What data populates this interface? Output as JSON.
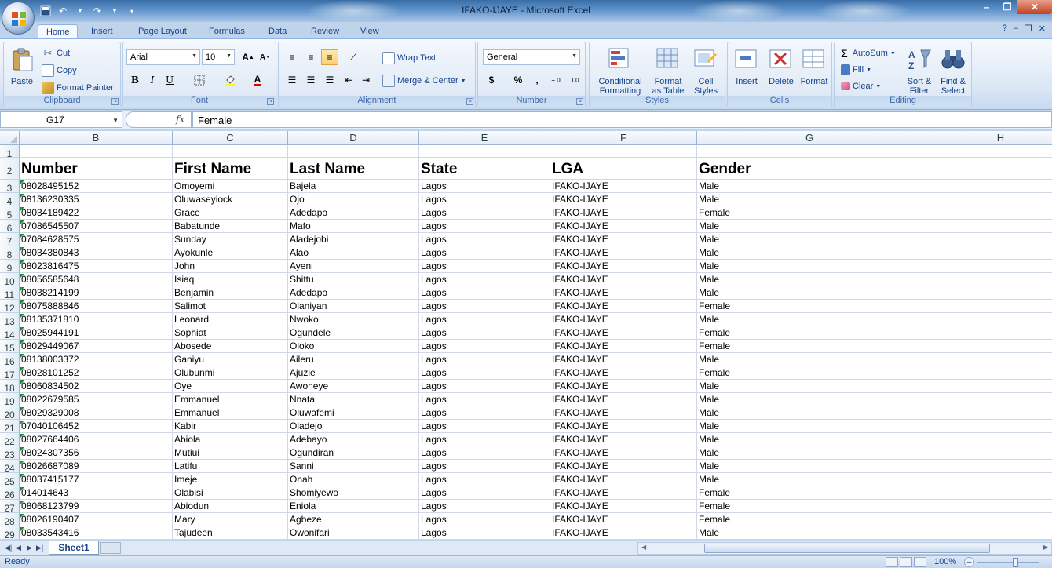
{
  "window": {
    "title": "IFAKO-IJAYE - Microsoft Excel"
  },
  "ribbon_tabs": [
    "Home",
    "Insert",
    "Page Layout",
    "Formulas",
    "Data",
    "Review",
    "View"
  ],
  "clipboard": {
    "paste": "Paste",
    "cut": "Cut",
    "copy": "Copy",
    "format_painter": "Format Painter",
    "label": "Clipboard"
  },
  "font": {
    "name": "Arial",
    "size": "10",
    "bold": "B",
    "italic": "I",
    "underline": "U",
    "label": "Font"
  },
  "alignment": {
    "wrap_text": "Wrap Text",
    "merge_center": "Merge & Center",
    "label": "Alignment"
  },
  "number": {
    "format": "General",
    "currency": "$",
    "percent": "%",
    "comma": ",",
    "label": "Number"
  },
  "styles": {
    "conditional_line1": "Conditional",
    "conditional_line2": "Formatting",
    "table_line1": "Format",
    "table_line2": "as Table",
    "cell_line1": "Cell",
    "cell_line2": "Styles",
    "label": "Styles"
  },
  "cells": {
    "insert": "Insert",
    "delete": "Delete",
    "format": "Format",
    "label": "Cells"
  },
  "editing": {
    "autosum": "AutoSum",
    "fill": "Fill",
    "clear": "Clear",
    "sort_line1": "Sort &",
    "sort_line2": "Filter",
    "find_line1": "Find &",
    "find_line2": "Select",
    "label": "Editing"
  },
  "formula_bar": {
    "name_box": "G17",
    "fx": "fx",
    "value": "Female"
  },
  "columns": [
    "B",
    "C",
    "D",
    "E",
    "F",
    "G",
    "H"
  ],
  "headers": [
    "Number",
    "First Name",
    "Last Name",
    "State",
    "LGA",
    "Gender"
  ],
  "rows": [
    [
      "08028495152",
      "Omoyemi",
      "Bajela",
      "Lagos",
      "IFAKO-IJAYE",
      "Male"
    ],
    [
      "08136230335",
      "Oluwaseyiock",
      "Ojo",
      "Lagos",
      "IFAKO-IJAYE",
      "Male"
    ],
    [
      "08034189422",
      "Grace",
      "Adedapo",
      "Lagos",
      "IFAKO-IJAYE",
      "Female"
    ],
    [
      "07086545507",
      "Babatunde",
      "Mafo",
      "Lagos",
      "IFAKO-IJAYE",
      "Male"
    ],
    [
      "07084628575",
      "Sunday",
      "Aladejobi",
      "Lagos",
      "IFAKO-IJAYE",
      "Male"
    ],
    [
      "08034380843",
      "Ayokunle",
      "Alao",
      "Lagos",
      "IFAKO-IJAYE",
      "Male"
    ],
    [
      "08023816475",
      "John",
      "Ayeni",
      "Lagos",
      "IFAKO-IJAYE",
      "Male"
    ],
    [
      "08056585648",
      "Isiaq",
      "Shittu",
      "Lagos",
      "IFAKO-IJAYE",
      "Male"
    ],
    [
      "08038214199",
      "Benjamin",
      "Adedapo",
      "Lagos",
      "IFAKO-IJAYE",
      "Male"
    ],
    [
      "08075888846",
      "Salimot",
      "Olaniyan",
      "Lagos",
      "IFAKO-IJAYE",
      "Female"
    ],
    [
      "08135371810",
      "Leonard",
      "Nwoko",
      "Lagos",
      "IFAKO-IJAYE",
      "Male"
    ],
    [
      "08025944191",
      "Sophiat",
      "Ogundele",
      "Lagos",
      "IFAKO-IJAYE",
      "Female"
    ],
    [
      "08029449067",
      "Abosede",
      "Oloko",
      "Lagos",
      "IFAKO-IJAYE",
      "Female"
    ],
    [
      "08138003372",
      "Ganiyu",
      "Aileru",
      "Lagos",
      "IFAKO-IJAYE",
      "Male"
    ],
    [
      "08028101252",
      "Olubunmi",
      "Ajuzie",
      "Lagos",
      "IFAKO-IJAYE",
      "Female"
    ],
    [
      "08060834502",
      "Oye",
      "Awoneye",
      "Lagos",
      "IFAKO-IJAYE",
      "Male"
    ],
    [
      "08022679585",
      "Emmanuel",
      "Nnata",
      "Lagos",
      "IFAKO-IJAYE",
      "Male"
    ],
    [
      "08029329008",
      "Emmanuel",
      "Oluwafemi",
      "Lagos",
      "IFAKO-IJAYE",
      "Male"
    ],
    [
      "07040106452",
      "Kabir",
      "Oladejo",
      "Lagos",
      "IFAKO-IJAYE",
      "Male"
    ],
    [
      "08027664406",
      "Abiola",
      "Adebayo",
      "Lagos",
      "IFAKO-IJAYE",
      "Male"
    ],
    [
      "08024307356",
      "Mutiui",
      "Ogundiran",
      "Lagos",
      "IFAKO-IJAYE",
      "Male"
    ],
    [
      "08026687089",
      "Latifu",
      "Sanni",
      "Lagos",
      "IFAKO-IJAYE",
      "Male"
    ],
    [
      "08037415177",
      "Imeje",
      "Onah",
      "Lagos",
      "IFAKO-IJAYE",
      "Male"
    ],
    [
      "014014643",
      "Olabisi",
      "Shomiyewo",
      "Lagos",
      "IFAKO-IJAYE",
      "Female"
    ],
    [
      "08068123799",
      "Abiodun",
      "Eniola",
      "Lagos",
      "IFAKO-IJAYE",
      "Female"
    ],
    [
      "08026190407",
      "Mary",
      "Agbeze",
      "Lagos",
      "IFAKO-IJAYE",
      "Female"
    ],
    [
      "08033543416",
      "Tajudeen",
      "Owonifari",
      "Lagos",
      "IFAKO-IJAYE",
      "Male"
    ]
  ],
  "sheet_tabs": [
    "Sheet1"
  ],
  "status": {
    "text": "Ready",
    "zoom": "100%",
    "zoom_level_percent": 100
  },
  "colors": {
    "accent": "#15428b",
    "ribbon": "#dbe7f6",
    "note_marker": "#1f8a3a"
  }
}
